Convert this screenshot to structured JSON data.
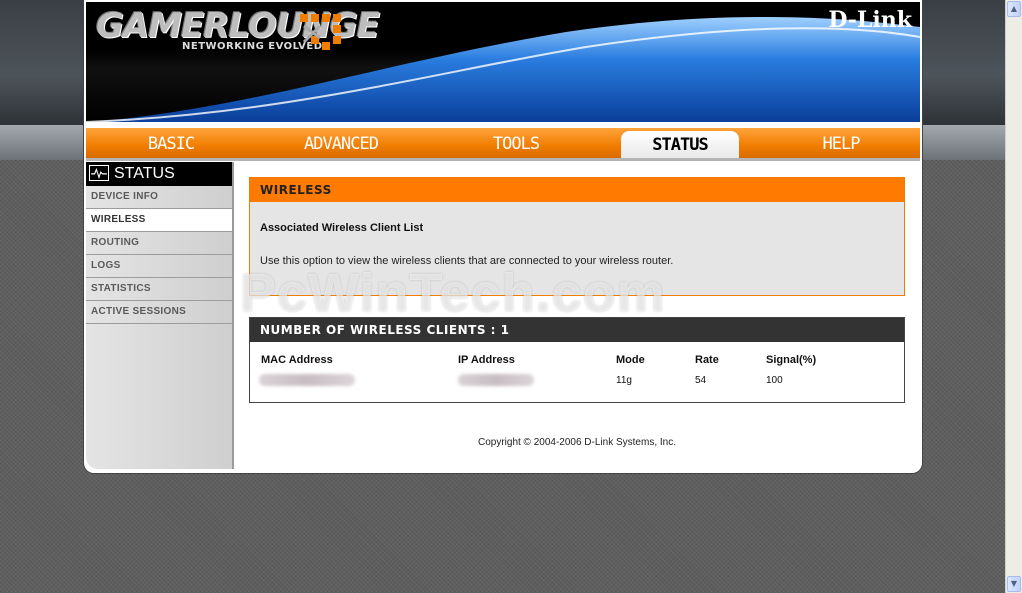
{
  "header": {
    "logo_text": "GAMERLOUNGE",
    "logo_tagline": "NETWORKING EVOLVED",
    "brand": "D-Link"
  },
  "nav": {
    "tabs": [
      {
        "label": "BASIC"
      },
      {
        "label": "ADVANCED"
      },
      {
        "label": "TOOLS"
      },
      {
        "label": "STATUS",
        "active": true
      },
      {
        "label": "HELP"
      }
    ]
  },
  "sidebar": {
    "title": "STATUS",
    "items": [
      {
        "label": "DEVICE INFO"
      },
      {
        "label": "WIRELESS",
        "active": true
      },
      {
        "label": "ROUTING"
      },
      {
        "label": "LOGS"
      },
      {
        "label": "STATISTICS"
      },
      {
        "label": "ACTIVE SESSIONS"
      }
    ]
  },
  "wireless": {
    "title": "WIRELESS",
    "subtitle": "Associated Wireless Client List",
    "description": "Use this option to view the wireless clients that are connected to your wireless router."
  },
  "clients": {
    "title": "NUMBER OF WIRELESS CLIENTS : 1",
    "columns": [
      "MAC Address",
      "IP Address",
      "Mode",
      "Rate",
      "Signal(%)"
    ],
    "rows": [
      {
        "mode": "11g",
        "rate": "54",
        "signal": "100"
      }
    ]
  },
  "footer": {
    "copyright": "Copyright © 2004-2006 D-Link Systems, Inc."
  },
  "watermark": "PcWinTech.com",
  "colors": {
    "accent_orange": "#ff7a00",
    "dark_bar": "#333333"
  }
}
